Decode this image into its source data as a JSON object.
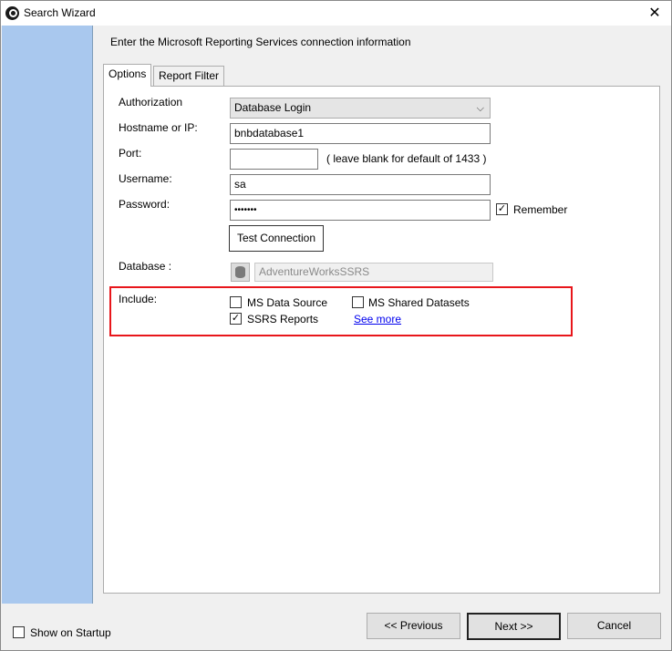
{
  "window": {
    "title": "Search Wizard",
    "close_glyph": "✕"
  },
  "header": {
    "text": "Enter the Microsoft Reporting Services connection information"
  },
  "tabs": [
    {
      "label": "Options"
    },
    {
      "label": "Report Filter"
    }
  ],
  "form": {
    "authorization": {
      "label": "Authorization",
      "value": "Database Login",
      "arrow": "⌵"
    },
    "hostname": {
      "label": "Hostname or IP:",
      "value": "bnbdatabase1"
    },
    "port": {
      "label": "Port:",
      "value": "",
      "hint": "( leave blank for default of 1433 )"
    },
    "username": {
      "label": "Username:",
      "value": "sa"
    },
    "password": {
      "label": "Password:",
      "value": "•••••••",
      "remember_label": "Remember",
      "remember_checked": true
    },
    "test_connection_label": "Test Connection",
    "database": {
      "label": "Database :",
      "value": "AdventureWorksSSRS"
    },
    "include": {
      "label": "Include:",
      "ms_data_source": {
        "label": "MS Data Source",
        "checked": false
      },
      "ms_shared_datasets": {
        "label": "MS Shared Datasets",
        "checked": false
      },
      "ssrs_reports": {
        "label": "SSRS Reports",
        "checked": true
      },
      "see_more_label": "See more"
    }
  },
  "footer": {
    "show_on_startup": {
      "label": "Show on Startup",
      "checked": false
    },
    "previous_label": "<< Previous",
    "next_label": "Next >>",
    "cancel_label": "Cancel"
  },
  "check_glyph": "✓",
  "colors": {
    "sidebar": "#a9c8ee",
    "highlight": "#e8161b",
    "link": "#0000ee"
  }
}
